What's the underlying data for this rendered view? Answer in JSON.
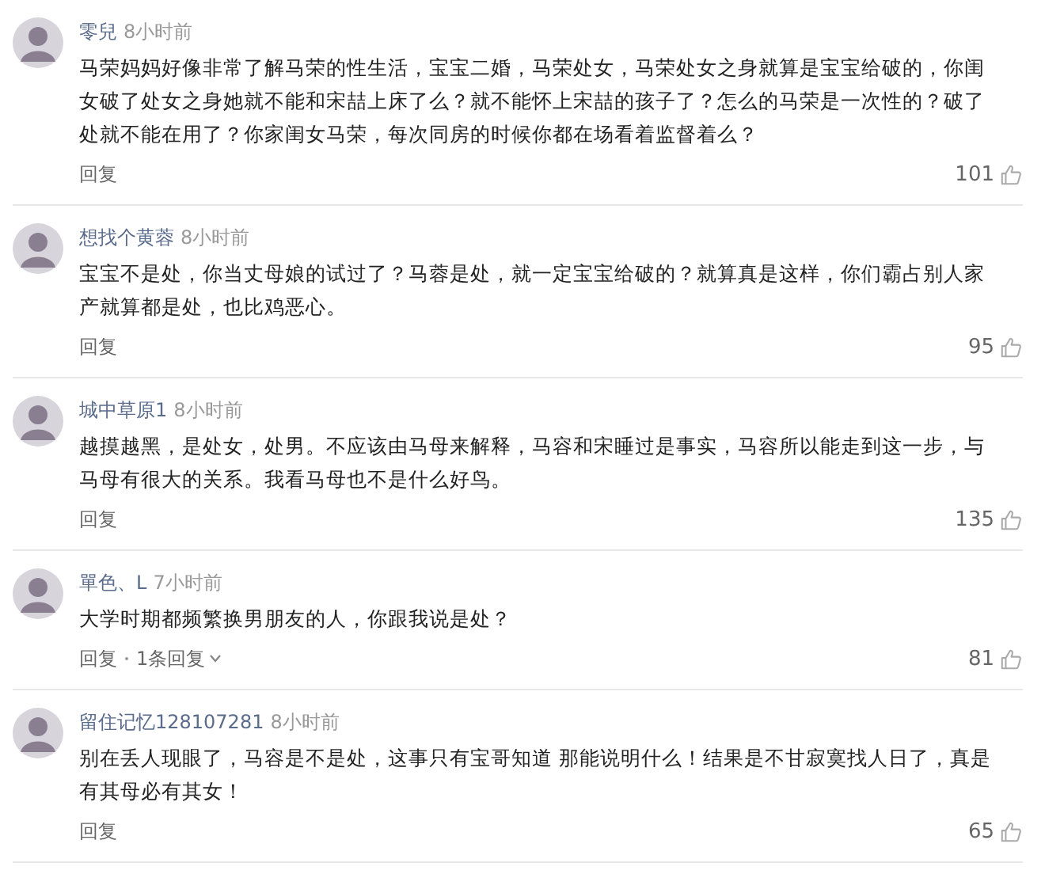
{
  "comments": [
    {
      "user": "零兒",
      "time": "8小时前",
      "text": "马荣妈妈好像非常了解马荣的性生活，宝宝二婚，马荣处女，马荣处女之身就算是宝宝给破的，你闺女破了处女之身她就不能和宋喆上床了么？就不能怀上宋喆的孩子了？怎么的马荣是一次性的？破了处就不能在用了？你家闺女马荣，每次同房的时候你都在场看着监督着么？",
      "reply": "回复",
      "likes": "101"
    },
    {
      "user": "想找个黄蓉",
      "time": "8小时前",
      "text": "宝宝不是处，你当丈母娘的试过了？马蓉是处，就一定宝宝给破的？就算真是这样，你们霸占别人家产就算都是处，也比鸡恶心。",
      "reply": "回复",
      "likes": "95"
    },
    {
      "user": "城中草原1",
      "time": "8小时前",
      "text": "越摸越黑，是处女，处男。不应该由马母来解释，马容和宋睡过是事实，马容所以能走到这一步，与马母有很大的关系。我看马母也不是什么好鸟。",
      "reply": "回复",
      "likes": "135"
    },
    {
      "user": "單色、L",
      "time": "7小时前",
      "text": "大学时期都频繁换男朋友的人，你跟我说是处？",
      "reply": "回复",
      "more_replies": "1条回复",
      "likes": "81"
    },
    {
      "user": "留住记忆128107281",
      "time": "8小时前",
      "text": "别在丢人现眼了，马容是不是处，这事只有宝哥知道 那能说明什么！结果是不甘寂寞找人日了，真是有其母必有其女！",
      "reply": "回复",
      "likes": "65"
    }
  ]
}
